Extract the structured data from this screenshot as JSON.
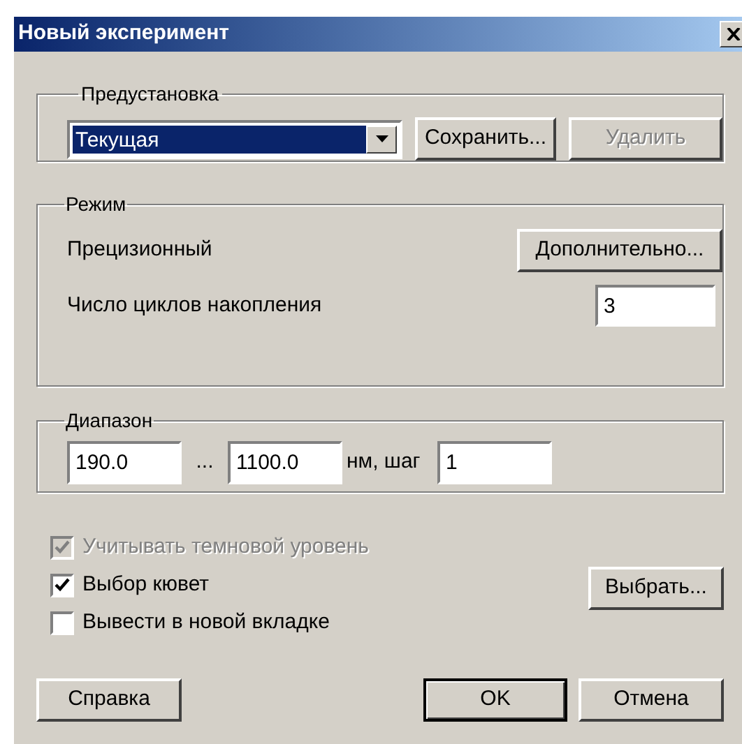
{
  "window": {
    "title": "Новый эксперимент"
  },
  "preset": {
    "label": "Предустановка",
    "combo": {
      "value": "Текущая"
    },
    "buttons": [
      {
        "label": "Сохранить...",
        "disabled": false
      },
      {
        "label": "Удалить",
        "disabled": true
      }
    ]
  },
  "mode": {
    "label": "Режим",
    "name": "Прецизионный",
    "advanced_button": "Дополнительно...",
    "cycles_label": "Число циклов накопления",
    "cycles_value": "3"
  },
  "range": {
    "label": "Диапазон",
    "from": "190.0",
    "separator": "...",
    "to": "1100.0",
    "unit": "нм, шаг",
    "step": "1"
  },
  "options": [
    {
      "label": "Учитывать темновой уровень",
      "checked": true,
      "disabled": true
    },
    {
      "label": "Выбор кювет",
      "checked": true,
      "disabled": false
    },
    {
      "label": "Вывести в новой вкладке",
      "checked": false,
      "disabled": false
    }
  ],
  "select_button": "Выбрать...",
  "footer_buttons": [
    {
      "label": "Справка",
      "default": false
    },
    {
      "label": "OK",
      "default": true
    },
    {
      "label": "Отмена",
      "default": false
    }
  ]
}
